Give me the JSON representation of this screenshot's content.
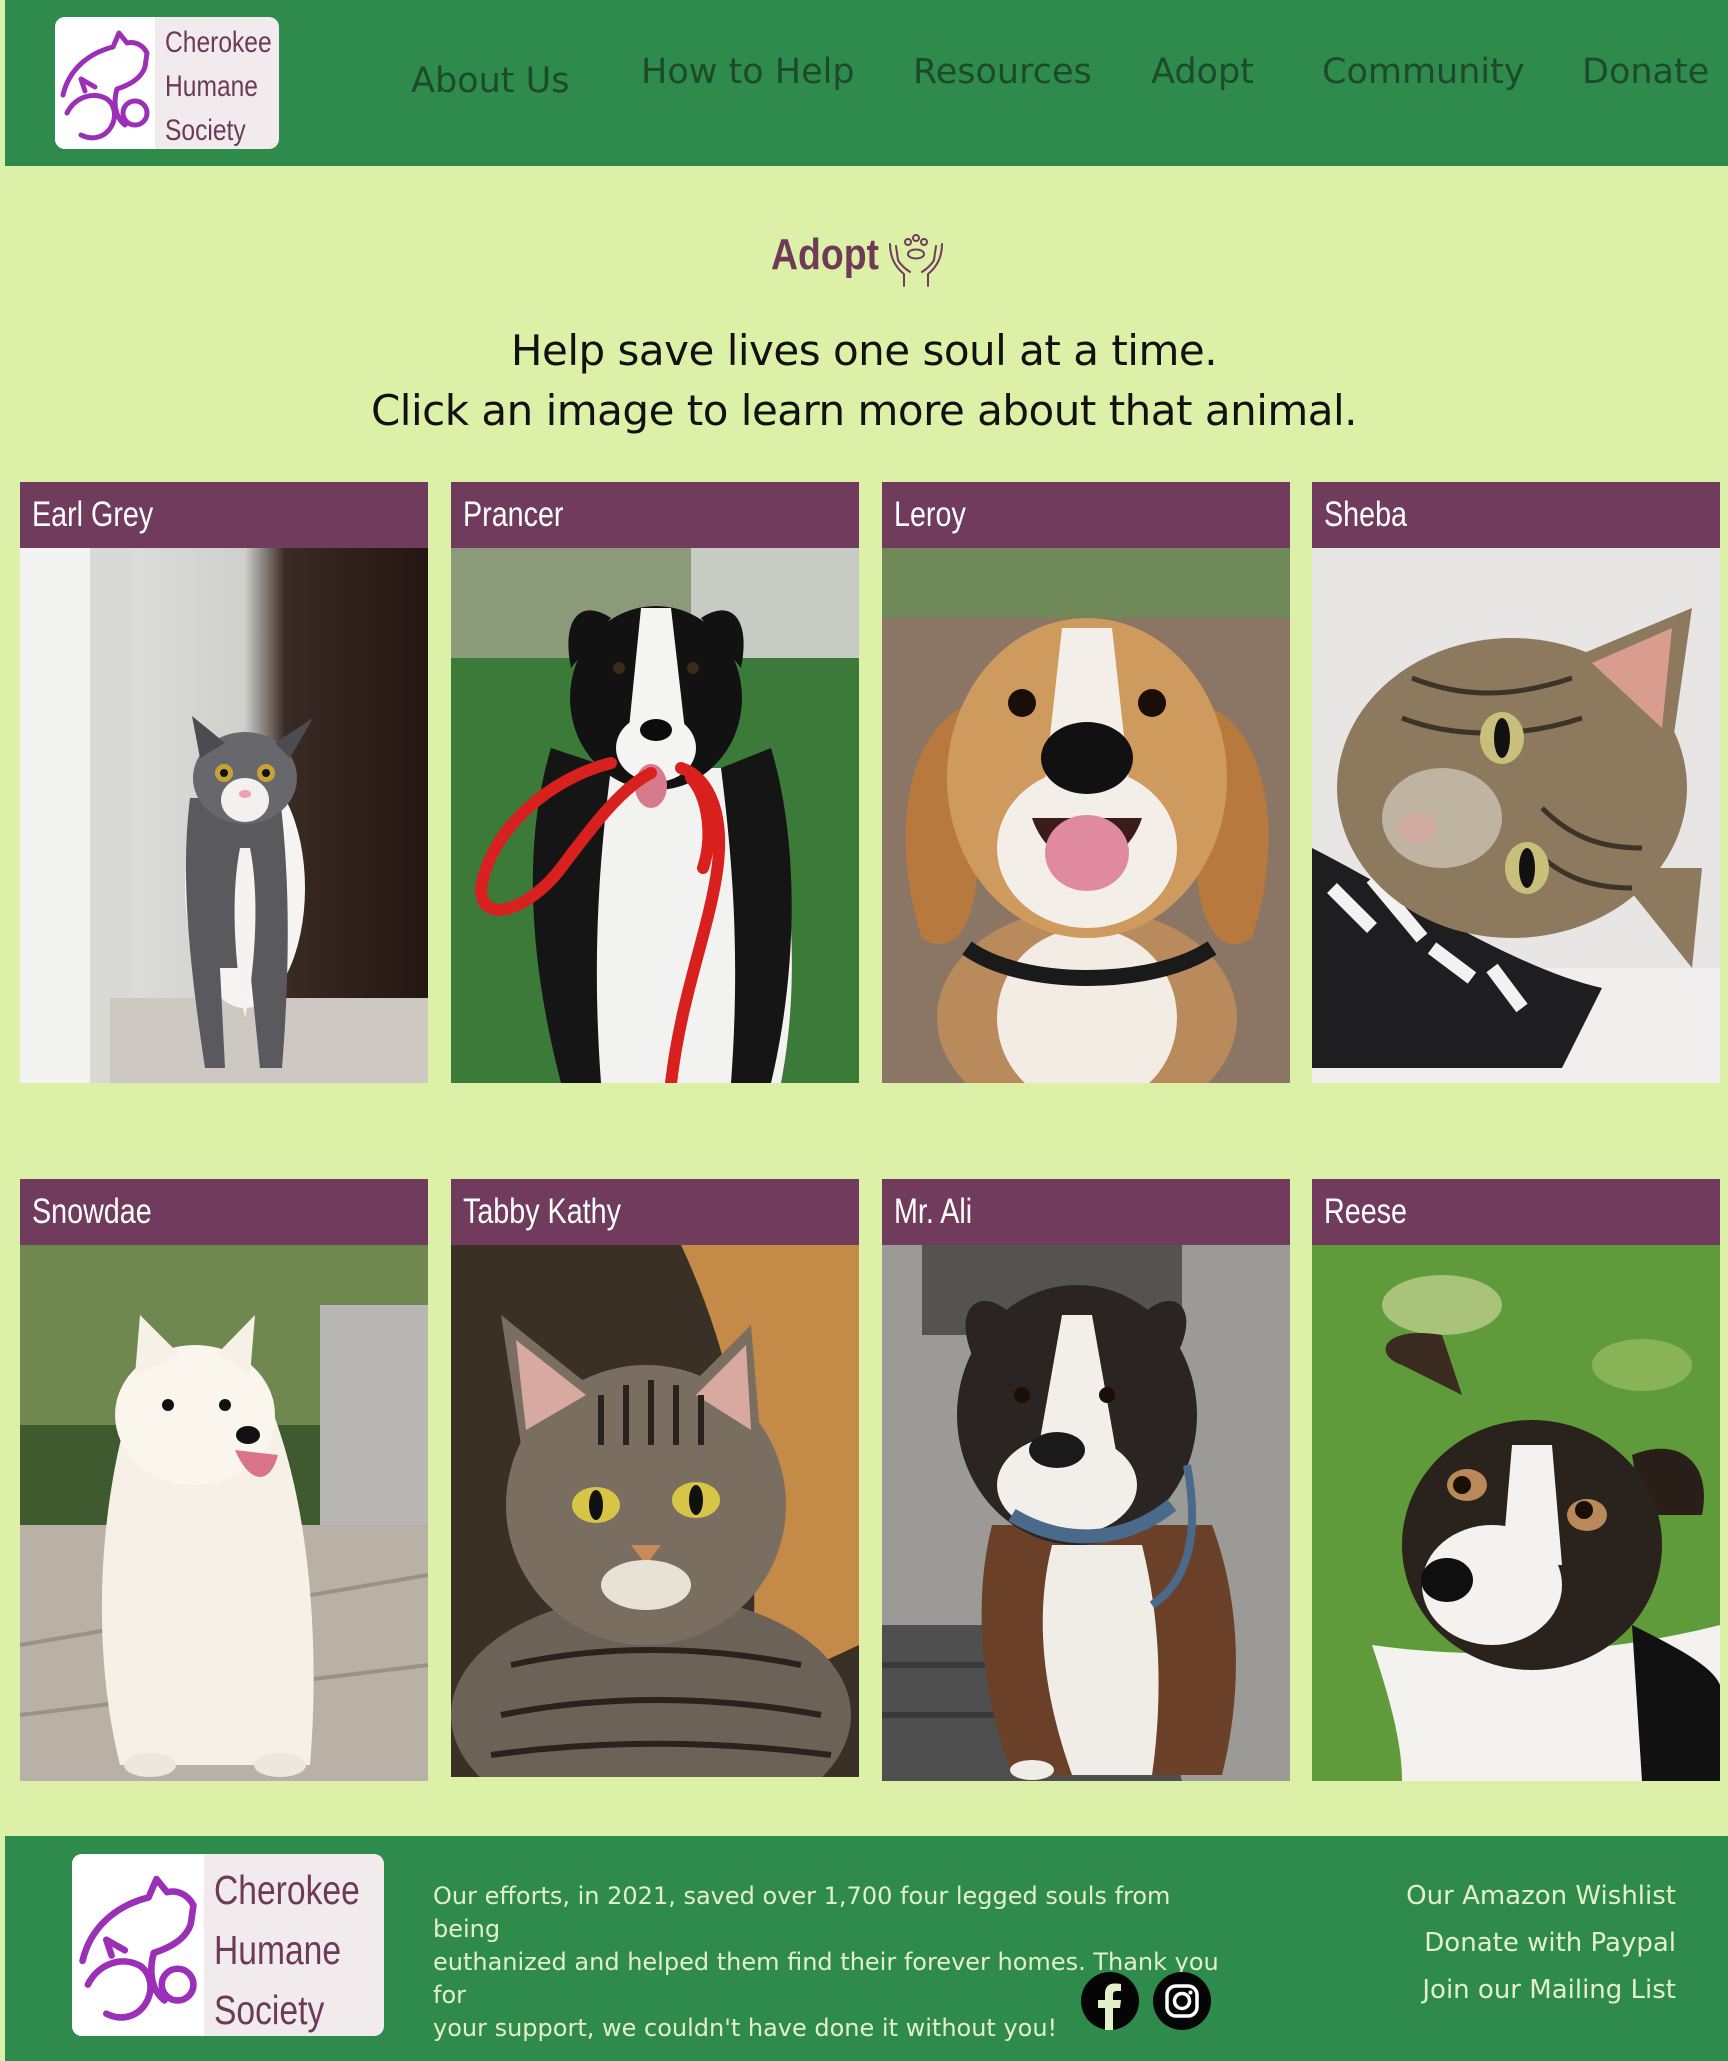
{
  "header": {
    "logo_line1": "Cherokee",
    "logo_line2": "Humane",
    "logo_line3": "Society",
    "logo_icon": "cat-and-dog-outline-icon",
    "nav": [
      "About Us",
      "How to Help",
      "Resources",
      "Adopt",
      "Community",
      "Donate"
    ]
  },
  "intro": {
    "title": "Adopt",
    "title_icon": "hands-holding-paw-icon",
    "line1": "Help save lives one soul at a time.",
    "line2": "Click an image to learn more about that animal."
  },
  "animals": [
    {
      "name": "Earl Grey",
      "species": "cat"
    },
    {
      "name": "Prancer",
      "species": "dog"
    },
    {
      "name": "Leroy",
      "species": "dog"
    },
    {
      "name": "Sheba",
      "species": "cat"
    },
    {
      "name": "Snowdae",
      "species": "dog"
    },
    {
      "name": "Tabby Kathy",
      "species": "cat"
    },
    {
      "name": "Mr. Ali",
      "species": "dog"
    },
    {
      "name": "Reese",
      "species": "dog"
    }
  ],
  "footer": {
    "logo_line1": "Cherokee",
    "logo_line2": "Humane",
    "logo_line3": "Society",
    "text_line1": "Our efforts, in 2021, saved over 1,700 four legged souls from being",
    "text_line2": "euthanized and helped them find their forever homes. Thank you for",
    "text_line3": "your support, we couldn't have done it without you!",
    "social_icons": [
      "facebook-icon",
      "instagram-icon"
    ],
    "links": [
      "Our Amazon Wishlist",
      "Donate with Paypal",
      "Join our Mailing List"
    ]
  },
  "colors": {
    "page_background": "#dcf0a8",
    "header_footer_green": "#2e8b4c",
    "brand_purple": "#703b5d",
    "logo_icon_purple": "#9b2fb8"
  }
}
